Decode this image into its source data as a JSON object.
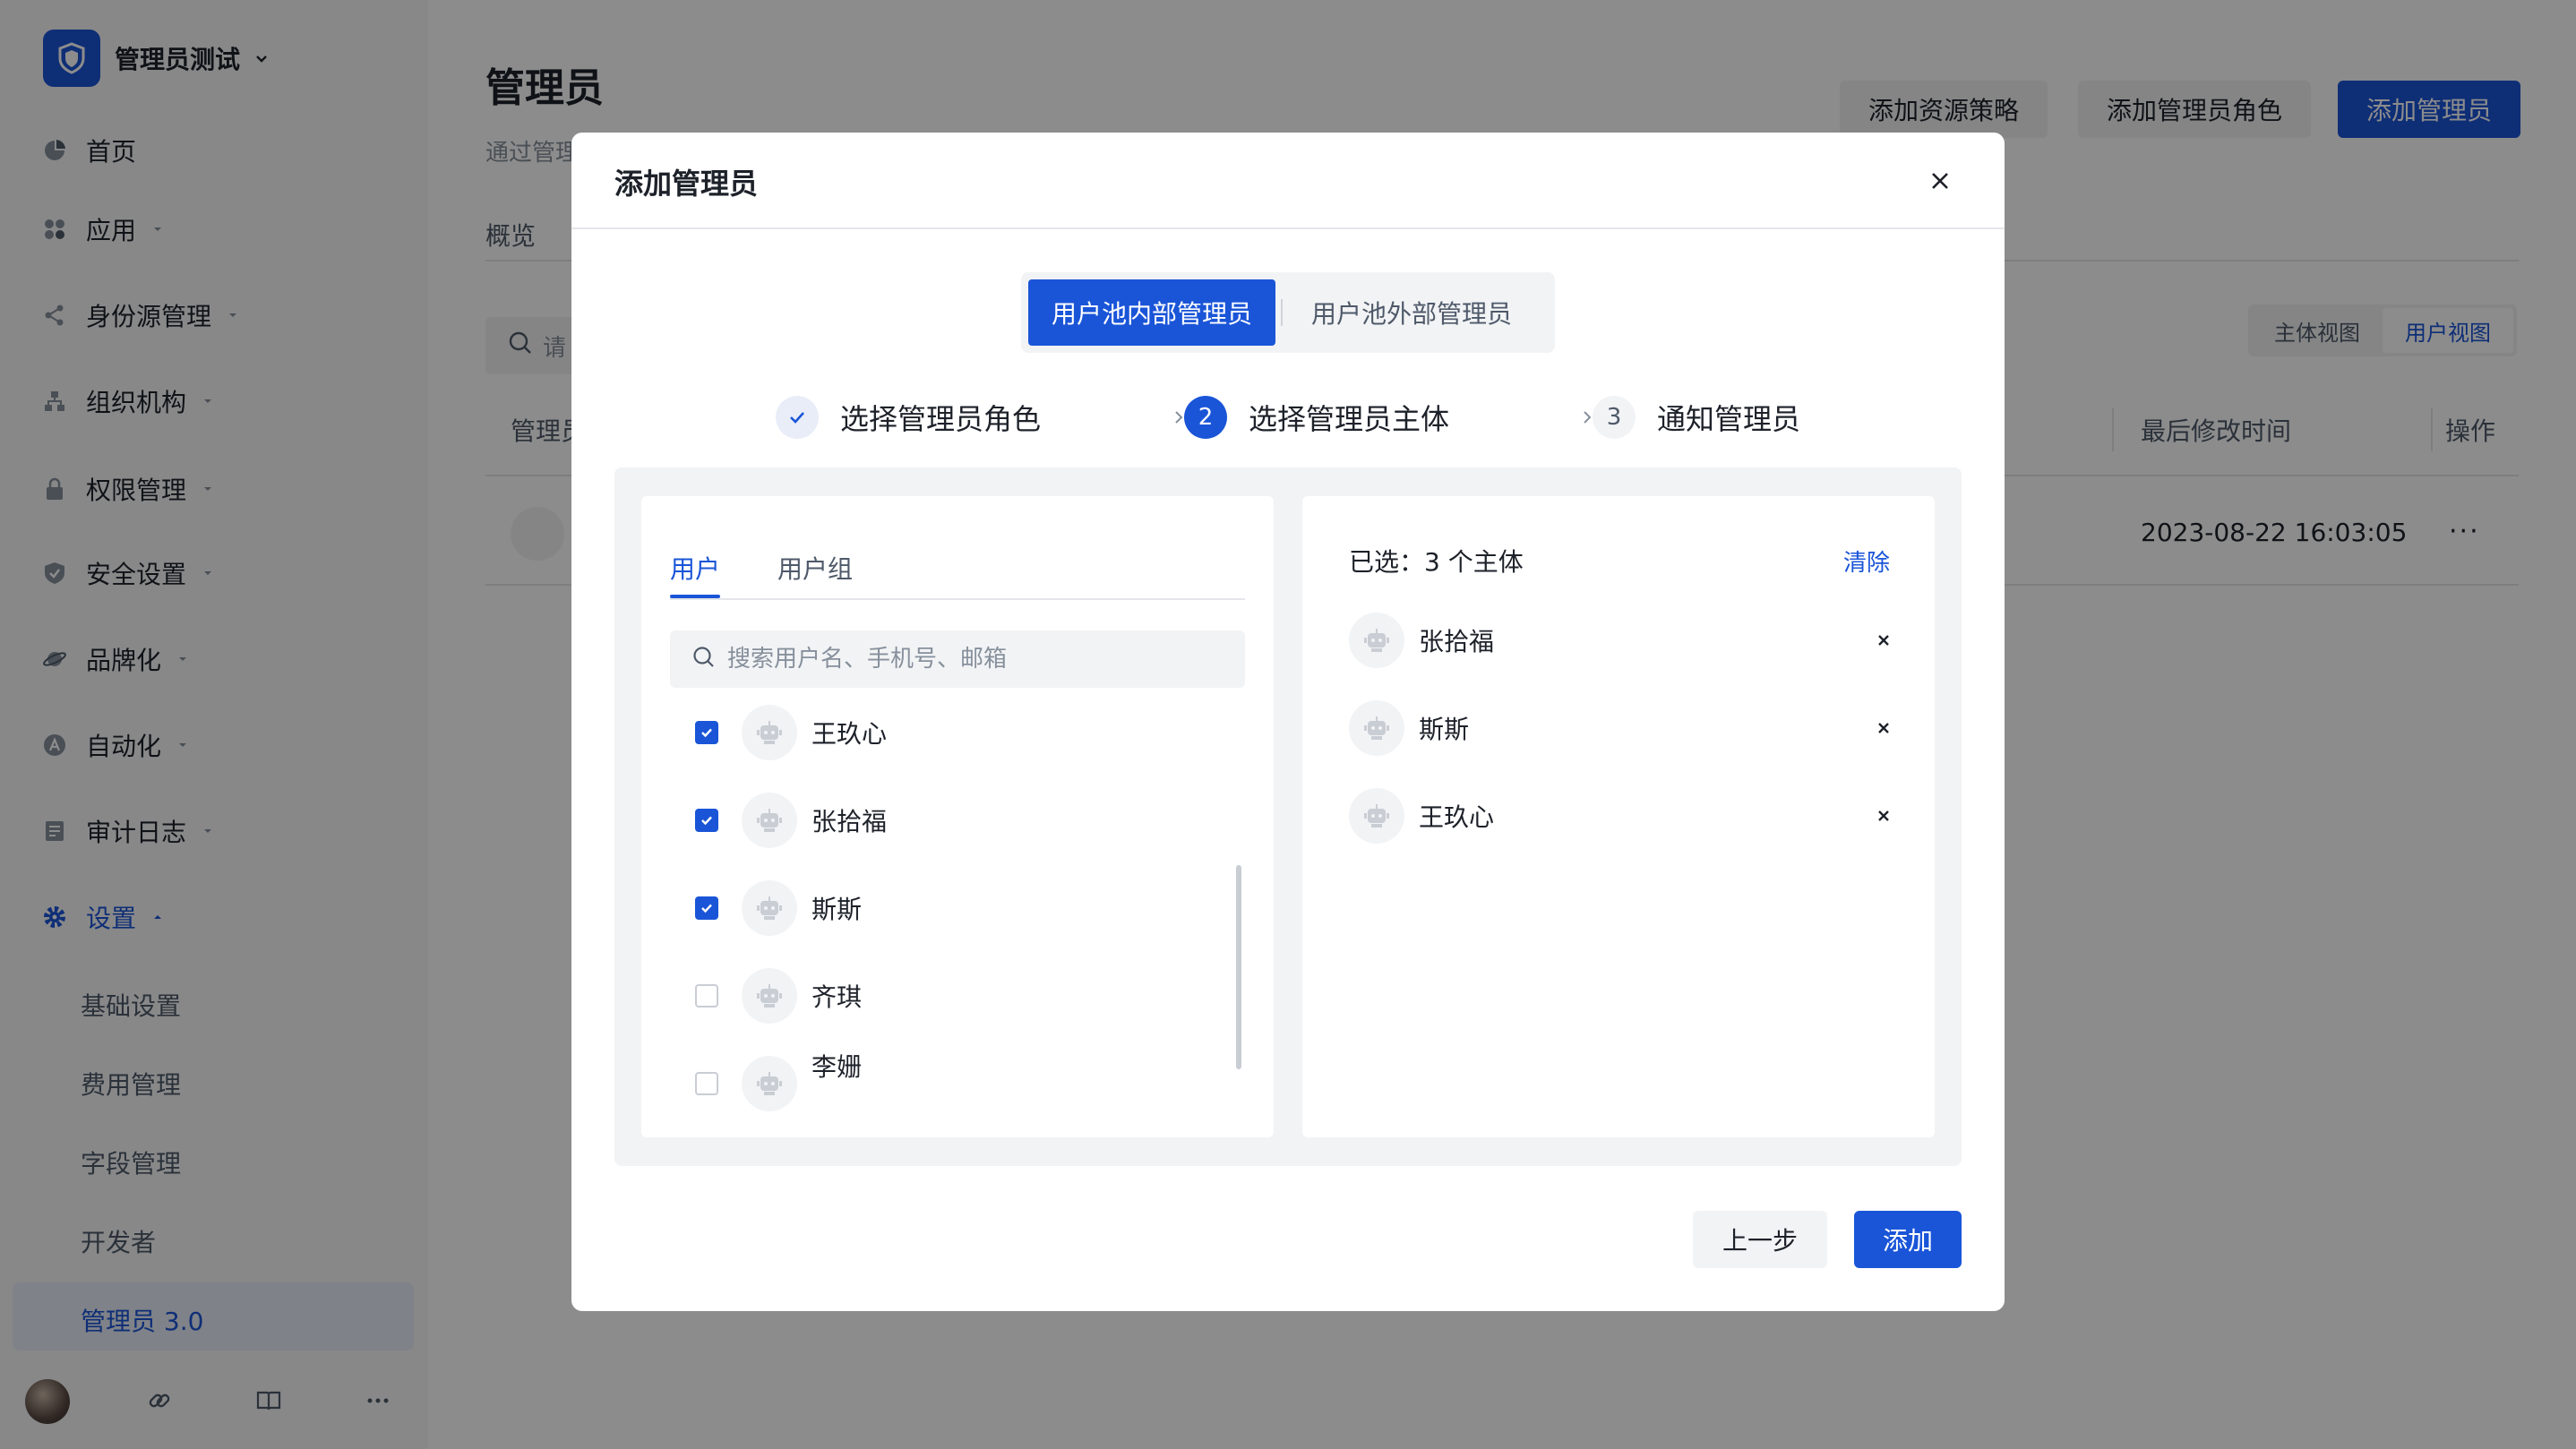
{
  "sidebar": {
    "brand": "管理员测试",
    "items": [
      {
        "label": "首页",
        "icon": "pie-chart-icon",
        "caret": false
      },
      {
        "label": "应用",
        "icon": "apps-icon",
        "caret": true
      },
      {
        "label": "身份源管理",
        "icon": "share-icon",
        "caret": true
      },
      {
        "label": "组织机构",
        "icon": "org-icon",
        "caret": true
      },
      {
        "label": "权限管理",
        "icon": "lock-icon",
        "caret": true
      },
      {
        "label": "安全设置",
        "icon": "shield-icon",
        "caret": true
      },
      {
        "label": "品牌化",
        "icon": "planet-icon",
        "caret": true
      },
      {
        "label": "自动化",
        "icon": "automation-icon",
        "caret": true
      },
      {
        "label": "审计日志",
        "icon": "log-icon",
        "caret": true
      },
      {
        "label": "设置",
        "icon": "gear-icon",
        "caret": true
      }
    ],
    "sub_items": [
      "基础设置",
      "费用管理",
      "字段管理",
      "开发者",
      "管理员 3.0"
    ]
  },
  "page": {
    "title": "管理员",
    "description": "通过管理",
    "buttons": [
      "添加资源策略",
      "添加管理员角色",
      "添加管理员"
    ],
    "tab": "概览",
    "search_placeholder": "请",
    "view_options": [
      "主体视图",
      "用户视图"
    ],
    "table_headers": [
      "管理员",
      "最后修改时间",
      "操作"
    ],
    "row": {
      "time": "2023-08-22 16:03:05",
      "more": "···"
    }
  },
  "modal": {
    "title": "添加管理员",
    "segments": [
      "用户池内部管理员",
      "用户池外部管理员"
    ],
    "steps": [
      {
        "label": "选择管理员角色",
        "marker": ""
      },
      {
        "label": "选择管理员主体",
        "marker": "2"
      },
      {
        "label": "通知管理员",
        "marker": "3"
      }
    ],
    "left_tabs": [
      "用户",
      "用户组"
    ],
    "search_placeholder": "搜索用户名、手机号、邮箱",
    "users": [
      {
        "name": "王玖心",
        "checked": true
      },
      {
        "name": "张拾福",
        "checked": true
      },
      {
        "name": "斯斯",
        "checked": true
      },
      {
        "name": "齐琪",
        "checked": false
      },
      {
        "name": "李姗",
        "checked": false
      }
    ],
    "selected_title": "已选：3 个主体",
    "clear_label": "清除",
    "selected": [
      "张拾福",
      "斯斯",
      "王玖心"
    ],
    "prev_label": "上一步",
    "add_label": "添加"
  },
  "colors": {
    "primary": "#1a55d8",
    "mask": "rgba(0,0,0,0.45)"
  }
}
